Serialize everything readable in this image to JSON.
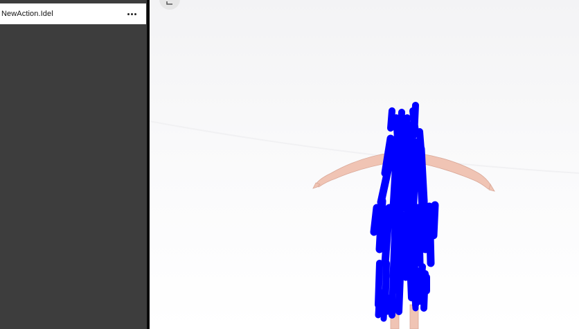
{
  "action_list": {
    "items": [
      {
        "name": "NewAction.Idel",
        "menu_icon": "more-horizontal-icon"
      }
    ]
  },
  "viewport": {
    "top_button_icon": "arrow-icon",
    "colors": {
      "background_top": "#f3f3f5",
      "background_bottom": "#ffffff",
      "annotation": "#0000ff",
      "skin": "#f0c4b4"
    }
  }
}
